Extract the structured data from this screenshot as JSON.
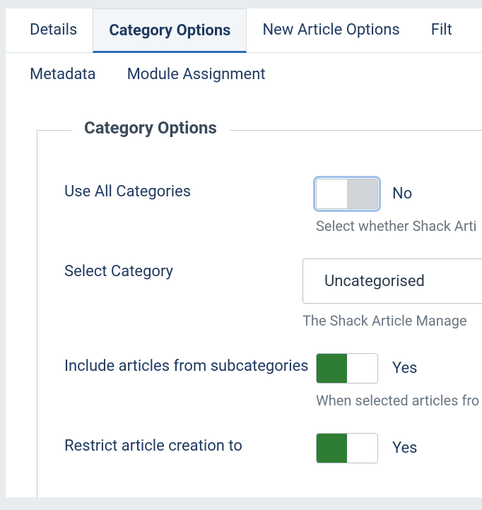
{
  "tabs": {
    "details": "Details",
    "category_options": "Category Options",
    "new_article_options": "New Article Options",
    "filtering": "Filt",
    "metadata": "Metadata",
    "module_assignment": "Module Assignment"
  },
  "fieldset": {
    "legend": "Category Options"
  },
  "fields": {
    "use_all": {
      "label": "Use All Categories",
      "value": "No",
      "help": "Select whether Shack Arti"
    },
    "select_category": {
      "label": "Select Category",
      "value": "Uncategorised",
      "help": "The Shack Article Manage"
    },
    "include_subcats": {
      "label": "Include articles from subcategories",
      "value": "Yes",
      "help": "When selected articles fro"
    },
    "restrict_creation": {
      "label": "Restrict article creation to",
      "value": "Yes"
    }
  }
}
